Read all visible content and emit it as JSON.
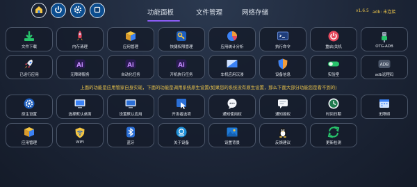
{
  "top_buttons": [
    {
      "name": "home-icon"
    },
    {
      "name": "power-icon"
    },
    {
      "name": "gear-icon"
    },
    {
      "name": "stop-icon"
    }
  ],
  "tabs": [
    {
      "label": "功能面板",
      "active": true
    },
    {
      "label": "文件管理",
      "active": false
    },
    {
      "label": "网络存储",
      "active": false
    }
  ],
  "version": "v1.6.5",
  "adb_status": "adb: 未连接",
  "accent_color": "#8b5cf6",
  "status_color": "#e8c24a",
  "row1": [
    {
      "label": "文件下载",
      "icon": "download-icon"
    },
    {
      "label": "内存清理",
      "icon": "rocket-icon"
    },
    {
      "label": "应用管理",
      "icon": "box-icon"
    },
    {
      "label": "快捷权限管理",
      "icon": "key-icon"
    },
    {
      "label": "应用统计分析",
      "icon": "pie-chart-icon"
    },
    {
      "label": "执行命令",
      "icon": "terminal-icon"
    },
    {
      "label": "重启/关机",
      "icon": "power-icon"
    },
    {
      "label": "OTG-ADB",
      "icon": "usb-icon"
    }
  ],
  "row2": [
    {
      "label": "已运行应用",
      "icon": "rocket-launch-icon"
    },
    {
      "label": "无障碍服务",
      "icon": "ai-icon"
    },
    {
      "label": "自动化任务",
      "icon": "ai-icon"
    },
    {
      "label": "开机执行任务",
      "icon": "ai-icon"
    },
    {
      "label": "车机应用沉浸",
      "icon": "screen-icon"
    },
    {
      "label": "设备信息",
      "icon": "shield-icon"
    },
    {
      "label": "实验室",
      "icon": "toggle-icon"
    },
    {
      "label": "adb远程码",
      "icon": "adb-icon",
      "badge": "ADB"
    }
  ],
  "notice": "上面的功能是应用管家自身实现，下面的功能是调用系统原生设置(如果您的系统没有原生设置，那么下面大部分功能您是看不到的)",
  "row3": [
    {
      "label": "原生设置",
      "icon": "gear-icon"
    },
    {
      "label": "选择默认桌面",
      "icon": "monitor-icon"
    },
    {
      "label": "设置默认应用",
      "icon": "monitor-icon"
    },
    {
      "label": "开发者选项",
      "icon": "cursor-icon"
    },
    {
      "label": "通知使用权",
      "icon": "chat-icon"
    },
    {
      "label": "通知授权",
      "icon": "message-icon"
    },
    {
      "label": "时间日期",
      "icon": "clock-icon"
    },
    {
      "label": "无障碍",
      "icon": "calendar-icon"
    }
  ],
  "row4": [
    {
      "label": "应用管理",
      "icon": "box-icon"
    },
    {
      "label": "WIFI",
      "icon": "wifi-icon"
    },
    {
      "label": "蓝牙",
      "icon": "bluetooth-icon"
    },
    {
      "label": "关于设备",
      "icon": "info-icon"
    },
    {
      "label": "设置背景",
      "icon": "image-icon"
    },
    {
      "label": "反馈建议",
      "icon": "penguin-icon"
    },
    {
      "label": "更新检测",
      "icon": "refresh-icon"
    }
  ]
}
